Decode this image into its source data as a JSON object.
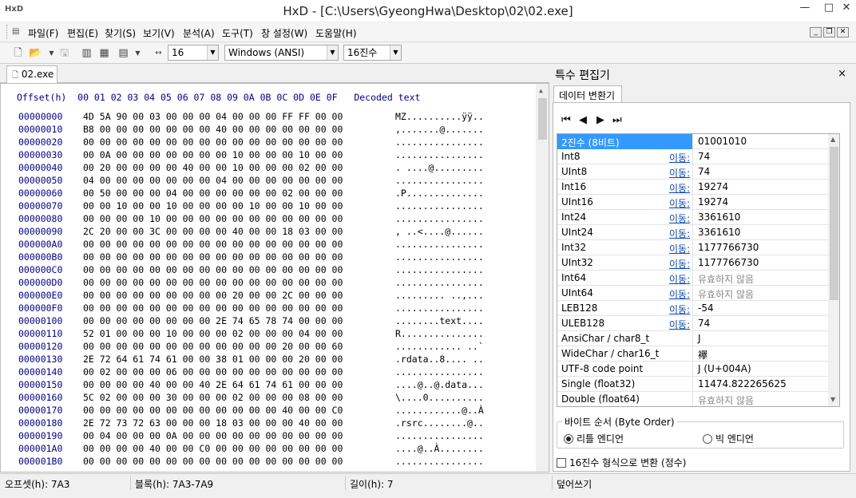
{
  "window": {
    "title": "HxD - [C:\\Users\\GyeongHwa\\Desktop\\02\\02.exe]",
    "app_icon": "HxD",
    "minimize": "—",
    "maximize": "□",
    "close": "✕"
  },
  "menu": [
    "파일(F)",
    "편집(E)",
    "찾기(S)",
    "보기(V)",
    "분석(A)",
    "도구(T)",
    "창 설정(W)",
    "도움말(H)"
  ],
  "toolbar": {
    "bytes_per_row": "16",
    "charset": "Windows (ANSI)",
    "offset_base": "16진수"
  },
  "tab": {
    "label": "02.exe"
  },
  "hex": {
    "header": "Offset(h)  00 01 02 03 04 05 06 07 08 09 0A 0B 0C 0D 0E 0F   Decoded text",
    "rows": [
      {
        "o": "00000000",
        "h": "4D 5A 90 00 03 00 00 00 04 00 00 00 FF FF 00 00",
        "d": "MZ..........ÿÿ.."
      },
      {
        "o": "00000010",
        "h": "B8 00 00 00 00 00 00 00 40 00 00 00 00 00 00 00",
        "d": ",.......@......."
      },
      {
        "o": "00000020",
        "h": "00 00 00 00 00 00 00 00 00 00 00 00 00 00 00 00",
        "d": "................"
      },
      {
        "o": "00000030",
        "h": "00 0A 00 00 00 00 00 00 00 10 00 00 00 10 00 00",
        "d": "................"
      },
      {
        "o": "00000040",
        "h": "00 20 00 00 00 00 40 00 00 10 00 00 00 02 00 00",
        "d": ". ....@........."
      },
      {
        "o": "00000050",
        "h": "04 00 00 00 00 00 00 00 04 00 00 00 00 00 00 00",
        "d": "................"
      },
      {
        "o": "00000060",
        "h": "00 50 00 00 00 04 00 00 00 00 00 00 02 00 00 00",
        "d": ".P.............."
      },
      {
        "o": "00000070",
        "h": "00 00 10 00 00 10 00 00 00 00 10 00 00 10 00 00",
        "d": "................"
      },
      {
        "o": "00000080",
        "h": "00 00 00 00 10 00 00 00 00 00 00 00 00 00 00 00",
        "d": "................"
      },
      {
        "o": "00000090",
        "h": "2C 20 00 00 3C 00 00 00 00 40 00 00 18 03 00 00",
        "d": ", ..<....@......"
      },
      {
        "o": "000000A0",
        "h": "00 00 00 00 00 00 00 00 00 00 00 00 00 00 00 00",
        "d": "................"
      },
      {
        "o": "000000B0",
        "h": "00 00 00 00 00 00 00 00 00 00 00 00 00 00 00 00",
        "d": "................"
      },
      {
        "o": "000000C0",
        "h": "00 00 00 00 00 00 00 00 00 00 00 00 00 00 00 00",
        "d": "................"
      },
      {
        "o": "000000D0",
        "h": "00 00 00 00 00 00 00 00 00 00 00 00 00 00 00 00",
        "d": "................"
      },
      {
        "o": "000000E0",
        "h": "00 00 00 00 00 00 00 00 00 20 00 00 2C 00 00 00",
        "d": "......... ..,..."
      },
      {
        "o": "000000F0",
        "h": "00 00 00 00 00 00 00 00 00 00 00 00 00 00 00 00",
        "d": "................"
      },
      {
        "o": "00000100",
        "h": "00 00 00 00 00 00 00 00 2E 74 65 78 74 00 00 00",
        "d": "........text...."
      },
      {
        "o": "00000110",
        "h": "52 01 00 00 00 10 00 00 00 02 00 00 00 04 00 00",
        "d": "R..............."
      },
      {
        "o": "00000120",
        "h": "00 00 00 00 00 00 00 00 00 00 00 00 20 00 00 60",
        "d": "............ ..`"
      },
      {
        "o": "00000130",
        "h": "2E 72 64 61 74 61 00 00 38 01 00 00 00 20 00 00",
        ".d": "",
        "d": ".rdata..8.... .."
      },
      {
        "o": "00000140",
        "h": "00 02 00 00 00 06 00 00 00 00 00 00 00 00 00 00",
        "d": "................"
      },
      {
        "o": "00000150",
        "h": "00 00 00 00 40 00 00 40 2E 64 61 74 61 00 00 00",
        "d": "....@..@.data..."
      },
      {
        "o": "00000160",
        "h": "5C 02 00 00 00 30 00 00 00 02 00 00 00 08 00 00",
        "d": "\\....0.........."
      },
      {
        "o": "00000170",
        "h": "00 00 00 00 00 00 00 00 00 00 00 00 40 00 00 C0",
        "d": "............@..À"
      },
      {
        "o": "00000180",
        "h": "2E 72 73 72 63 00 00 00 18 03 00 00 00 40 00 00",
        "d": ".rsrc........@.."
      },
      {
        "o": "00000190",
        "h": "00 04 00 00 00 0A 00 00 00 00 00 00 00 00 00 00",
        "d": "................"
      },
      {
        "o": "000001A0",
        "h": "00 00 00 00 40 00 00 C0 00 00 00 00 00 00 00 00",
        "d": "....@..À........"
      },
      {
        "o": "000001B0",
        "h": "00 00 00 00 00 00 00 00 00 00 00 00 00 00 00 00",
        "d": "................"
      }
    ]
  },
  "panel": {
    "title": "특수 편집기",
    "close": "×",
    "sub_tab": "데이터 변환기",
    "rows": [
      {
        "n": "2진수 (8비트)",
        "l": "",
        "v": "01001010",
        "inv": false,
        "sel": true
      },
      {
        "n": "Int8",
        "l": "이동:",
        "v": "74",
        "inv": false
      },
      {
        "n": "UInt8",
        "l": "이동:",
        "v": "74",
        "inv": false
      },
      {
        "n": "Int16",
        "l": "이동:",
        "v": "19274",
        "inv": false
      },
      {
        "n": "UInt16",
        "l": "이동:",
        "v": "19274",
        "inv": false
      },
      {
        "n": "Int24",
        "l": "이동:",
        "v": "3361610",
        "inv": false
      },
      {
        "n": "UInt24",
        "l": "이동:",
        "v": "3361610",
        "inv": false
      },
      {
        "n": "Int32",
        "l": "이동:",
        "v": "1177766730",
        "inv": false
      },
      {
        "n": "UInt32",
        "l": "이동:",
        "v": "1177766730",
        "inv": false
      },
      {
        "n": "Int64",
        "l": "이동:",
        "v": "유효하지 않음",
        "inv": true
      },
      {
        "n": "UInt64",
        "l": "이동:",
        "v": "유효하지 않음",
        "inv": true
      },
      {
        "n": "LEB128",
        "l": "이동:",
        "v": "-54",
        "inv": false
      },
      {
        "n": "ULEB128",
        "l": "이동:",
        "v": "74",
        "inv": false
      },
      {
        "n": "AnsiChar / char8_t",
        "l": "",
        "v": "J",
        "inv": false
      },
      {
        "n": "WideChar / char16_t",
        "l": "",
        "v": "襷",
        "inv": false
      },
      {
        "n": "UTF-8 code point",
        "l": "",
        "v": "J (U+004A)",
        "inv": false
      },
      {
        "n": "Single (float32)",
        "l": "",
        "v": "11474.822265625",
        "inv": false
      },
      {
        "n": "Double (float64)",
        "l": "",
        "v": "유효하지 않음",
        "inv": true
      }
    ],
    "byte_order": {
      "label": "바이트 순서 (Byte Order)",
      "little": "리틀 엔디언",
      "big": "빅 엔디언"
    },
    "hex_checkbox": "16진수 형식으로 변환 (정수)"
  },
  "status": {
    "offset": "오프셋(h): 7A3",
    "block": "블록(h): 7A3-7A9",
    "length": "길이(h): 7",
    "mode": "덮어쓰기"
  }
}
